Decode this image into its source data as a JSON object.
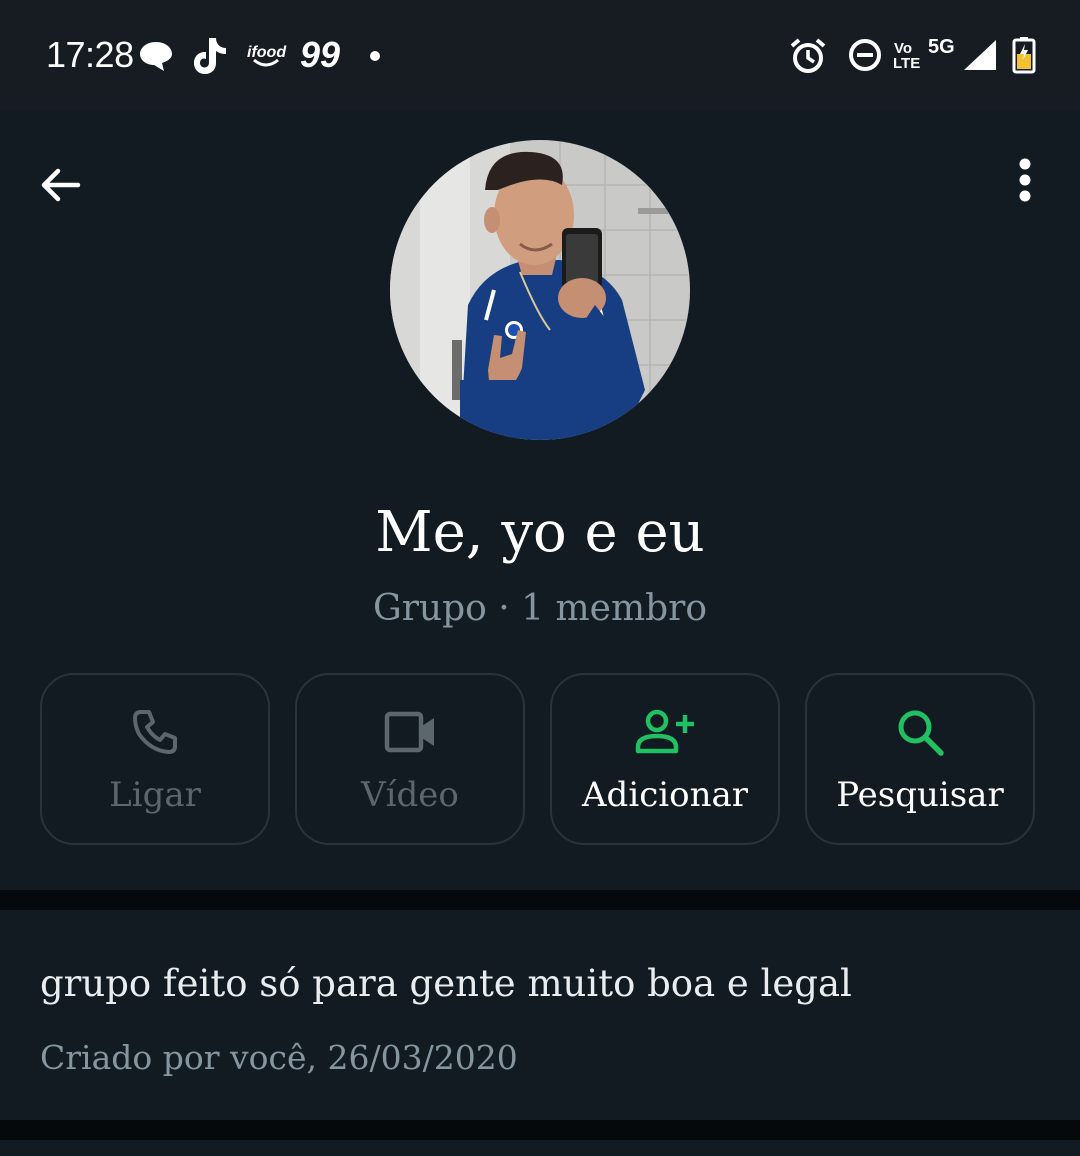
{
  "status_bar": {
    "time": "17:28",
    "notification_icons": [
      "chat-bubble-icon",
      "tiktok-icon",
      "ifood-icon",
      "99-app-icon",
      "dot-icon"
    ],
    "ifood_label": "ifood",
    "app_99_label": "99",
    "right_icons": [
      "alarm-icon",
      "do-not-disturb-icon",
      "volte-icon",
      "5g-icon",
      "signal-icon",
      "battery-icon"
    ],
    "volte_top": "Vo",
    "volte_bottom": "LTE",
    "network": "5G"
  },
  "header": {
    "group_name": "Me, yo e eu",
    "group_meta": "Grupo · 1 membro"
  },
  "actions": [
    {
      "label": "Ligar",
      "icon": "phone-icon",
      "enabled": false
    },
    {
      "label": "Vídeo",
      "icon": "video-icon",
      "enabled": false
    },
    {
      "label": "Adicionar",
      "icon": "add-person-icon",
      "enabled": true
    },
    {
      "label": "Pesquisar",
      "icon": "search-icon",
      "enabled": true
    }
  ],
  "description": {
    "text": "grupo feito só para gente muito boa e legal",
    "created": "Criado por você, 26/03/2020"
  },
  "colors": {
    "accent": "#21c063",
    "background": "#111b21",
    "statusbar": "#161c21",
    "muted_text": "#8696a0",
    "disabled": "#5b666d"
  }
}
